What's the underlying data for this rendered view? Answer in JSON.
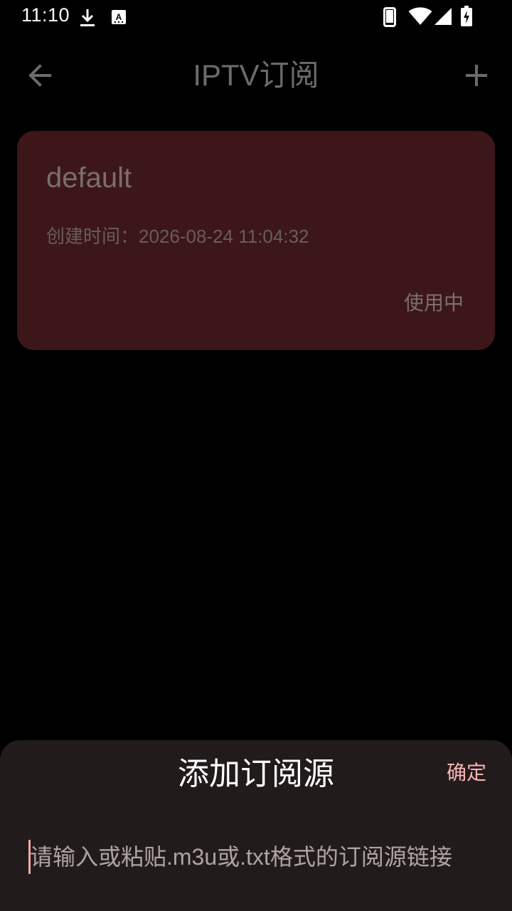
{
  "status_bar": {
    "time": "11:10",
    "icons": [
      "download-icon",
      "keyboard-icon",
      "phone-icon",
      "wifi-icon",
      "signal-icon",
      "battery-charging-icon"
    ]
  },
  "app_bar": {
    "title": "IPTV订阅",
    "back_icon": "arrow-left-icon",
    "add_icon": "plus-icon"
  },
  "subscriptions": [
    {
      "name": "default",
      "created": "创建时间：2026-08-24 11:04:32",
      "status": "使用中"
    }
  ],
  "add_sheet": {
    "title": "添加订阅源",
    "confirm_label": "确定",
    "input": {
      "value": "",
      "placeholder": "请输入或粘贴.m3u或.txt格式的订阅源链接"
    }
  },
  "colors": {
    "background": "#000000",
    "card_background": "#3d1619",
    "sheet_background": "#221b1b",
    "accent": "#f6b7b5"
  }
}
